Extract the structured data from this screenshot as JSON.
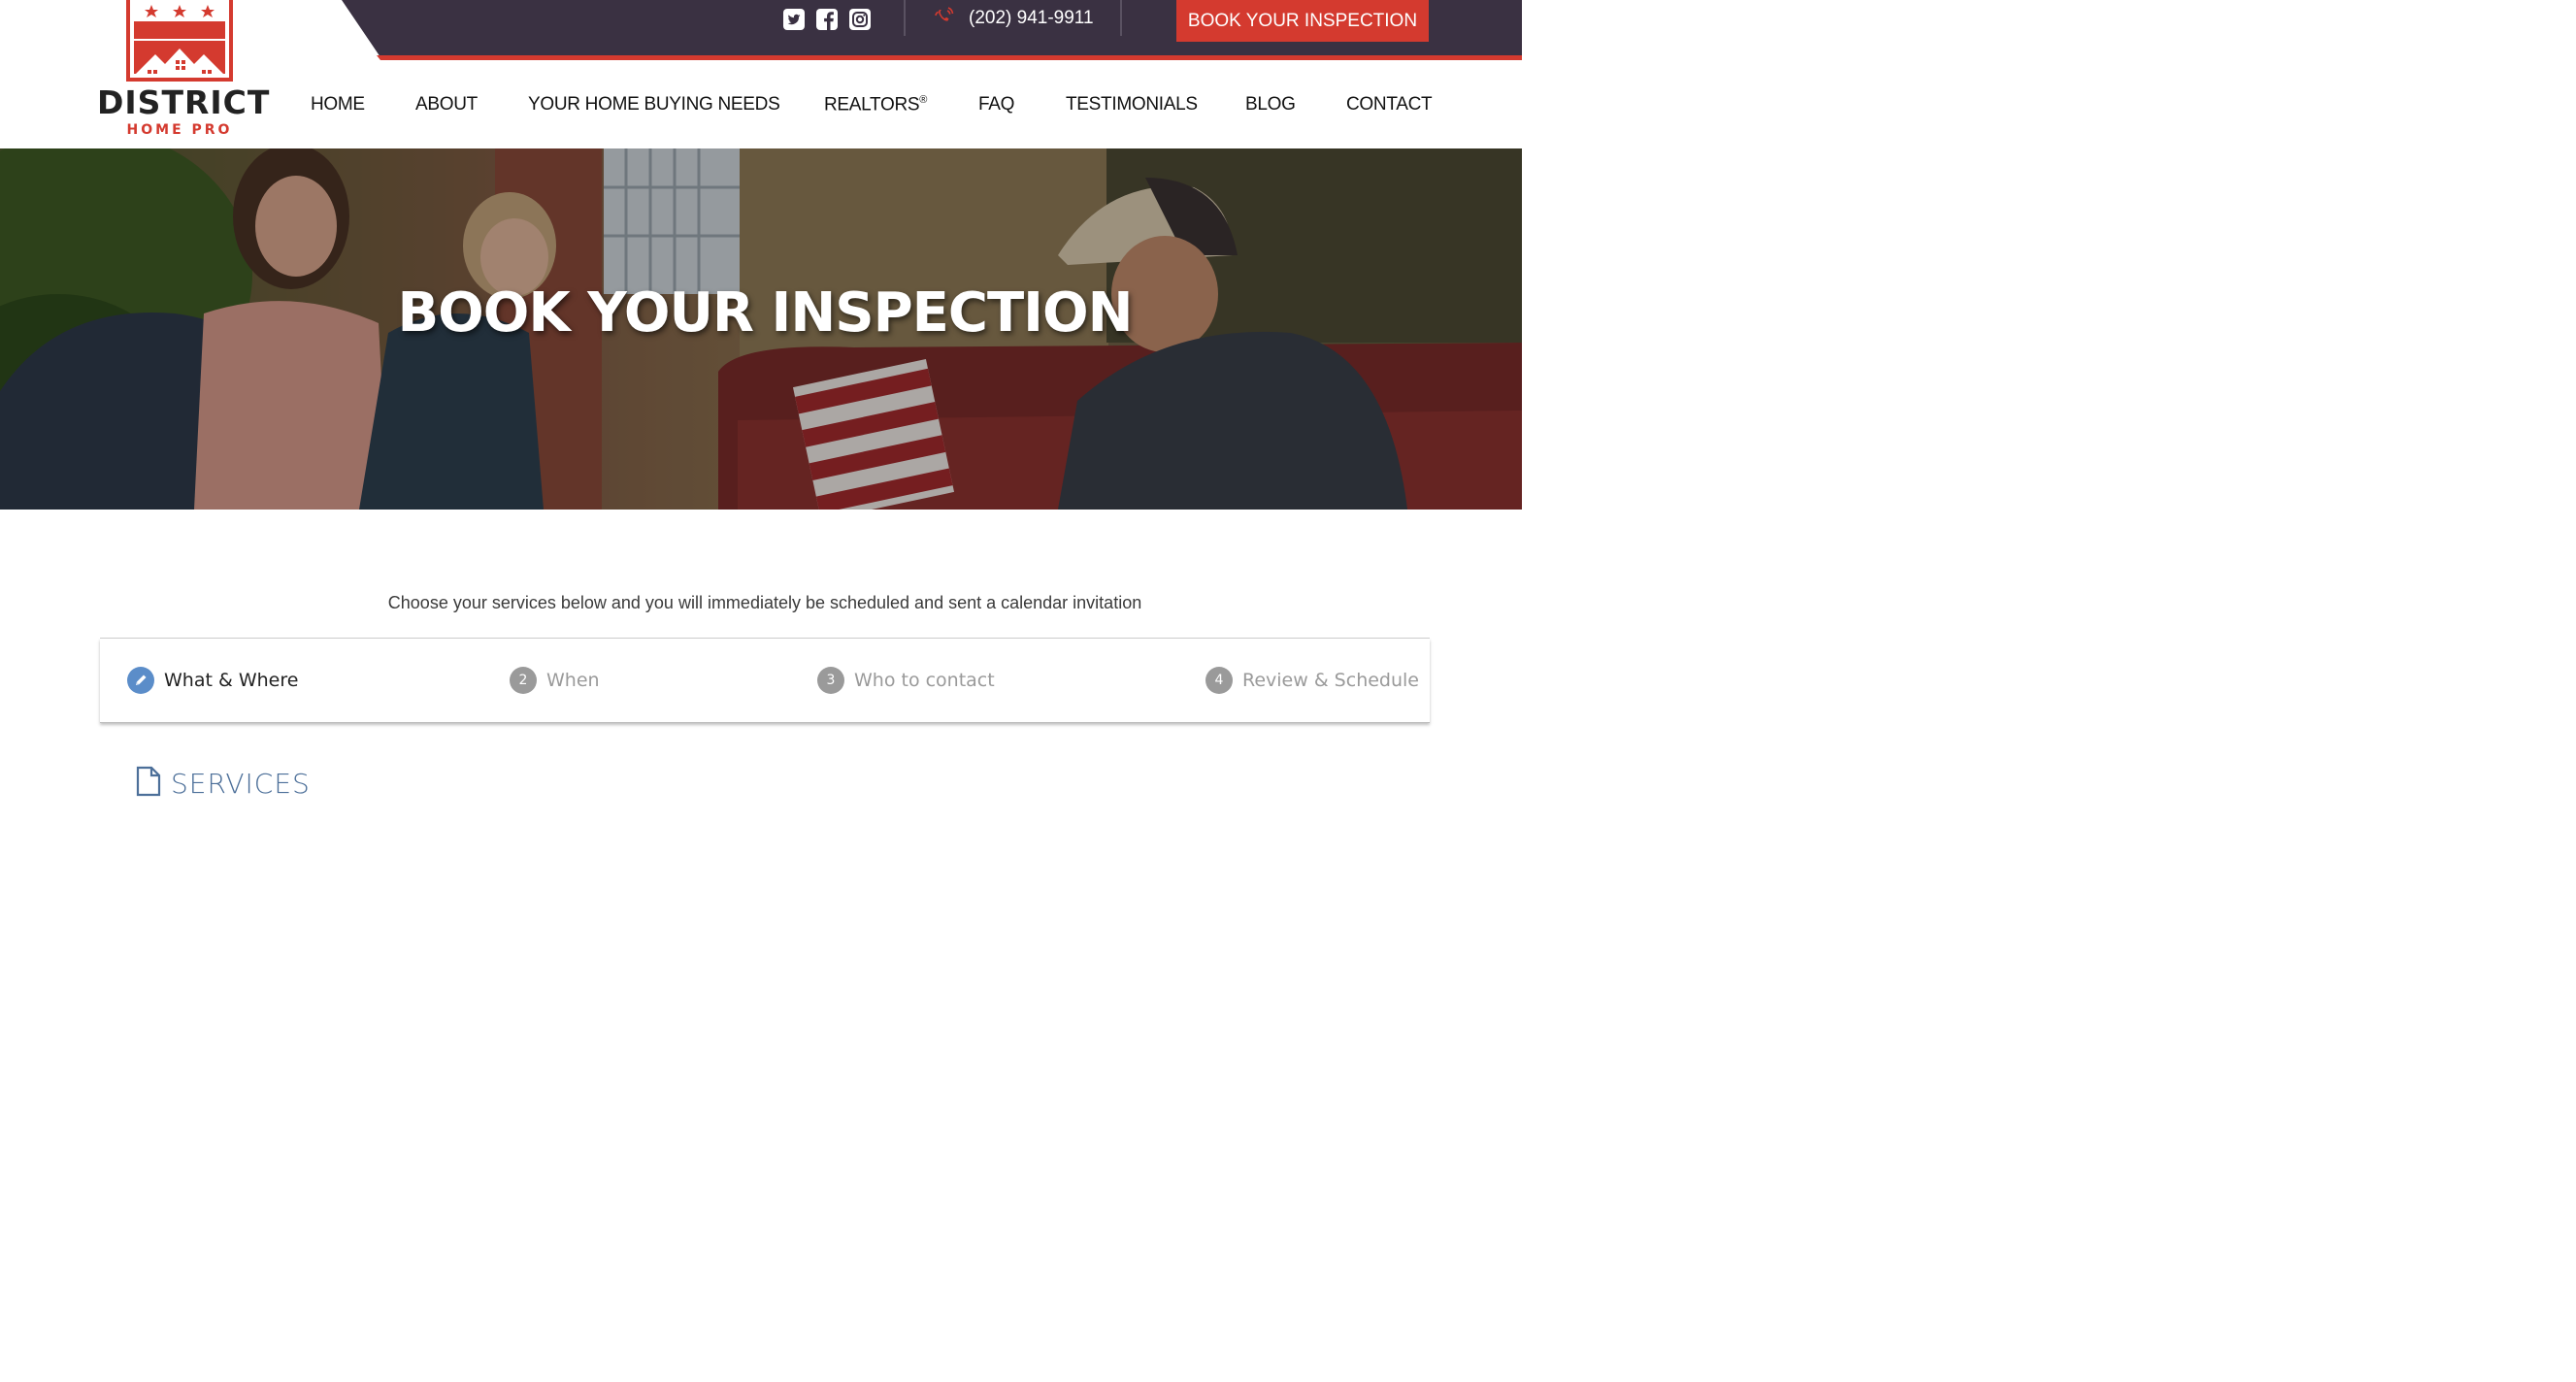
{
  "header": {
    "logo": {
      "word": "DISTRICT",
      "sub": "HOME PRO"
    },
    "social": [
      {
        "name": "twitter-icon"
      },
      {
        "name": "facebook-icon"
      },
      {
        "name": "instagram-icon"
      }
    ],
    "phone": "(202) 941-9911",
    "book_button": "BOOK YOUR INSPECTION",
    "nav": [
      "HOME",
      "ABOUT",
      "YOUR HOME BUYING NEEDS",
      "REALTORS",
      "FAQ",
      "TESTIMONIALS",
      "BLOG",
      "CONTACT"
    ],
    "realtors_mark": "®"
  },
  "hero": {
    "title": "BOOK YOUR INSPECTION"
  },
  "intro": "Choose your services below and you will immediately be scheduled and sent a calendar invitation",
  "steps": [
    {
      "num": "1",
      "label": "What & Where",
      "active": true
    },
    {
      "num": "2",
      "label": "When",
      "active": false
    },
    {
      "num": "3",
      "label": "Who to contact",
      "active": false
    },
    {
      "num": "4",
      "label": "Review & Schedule",
      "active": false
    }
  ],
  "services": {
    "title": "SERVICES"
  },
  "colors": {
    "dark": "#3a3142",
    "brand_red": "#d43a2f",
    "step_active": "#5b8dc9",
    "services_blue": "#4c6f99"
  }
}
